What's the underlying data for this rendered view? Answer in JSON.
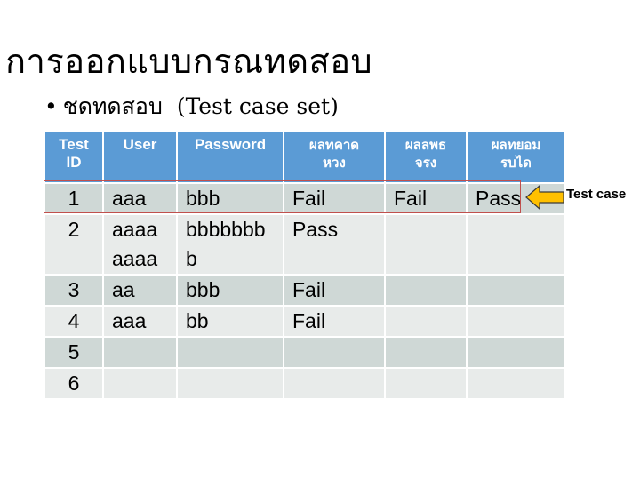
{
  "slide": {
    "title": "การออกแบบกรณทดสอบ",
    "subtitle_bullet": "•",
    "subtitle_thai": "ชดทดสอบ",
    "subtitle_en": "(Test case set)"
  },
  "table": {
    "headers": [
      [
        "Test",
        "ID"
      ],
      [
        "User",
        ""
      ],
      [
        "Password",
        ""
      ],
      [
        "ผลทคาด",
        "หวง"
      ],
      [
        "ผลลพธ",
        "จรง"
      ],
      [
        "ผลทยอม",
        "รบได"
      ]
    ],
    "rows": [
      {
        "id": "1",
        "user": [
          "aaa"
        ],
        "password": [
          "bbb"
        ],
        "expected": "Fail",
        "actual": "Fail",
        "acceptable": "Pass"
      },
      {
        "id": "2",
        "user": [
          "aaaa",
          "aaaa"
        ],
        "password": [
          "bbbbbbb",
          "b"
        ],
        "expected": "Pass",
        "actual": "",
        "acceptable": ""
      },
      {
        "id": "3",
        "user": [
          "aa"
        ],
        "password": [
          "bbb"
        ],
        "expected": "Fail",
        "actual": "",
        "acceptable": ""
      },
      {
        "id": "4",
        "user": [
          "aaa"
        ],
        "password": [
          "bb"
        ],
        "expected": "Fail",
        "actual": "",
        "acceptable": ""
      },
      {
        "id": "5",
        "user": [
          ""
        ],
        "password": [
          ""
        ],
        "expected": "",
        "actual": "",
        "acceptable": ""
      },
      {
        "id": "6",
        "user": [
          ""
        ],
        "password": [
          ""
        ],
        "expected": "",
        "actual": "",
        "acceptable": ""
      }
    ]
  },
  "callout": {
    "label": "Test case",
    "arrow_icon": "left-arrow-icon"
  },
  "colors": {
    "header_bg": "#5b9bd5",
    "row_dark": "#cfd8d6",
    "row_light": "#e8ebea",
    "highlight_border": "#c0504d",
    "arrow_fill": "#ffc000"
  }
}
